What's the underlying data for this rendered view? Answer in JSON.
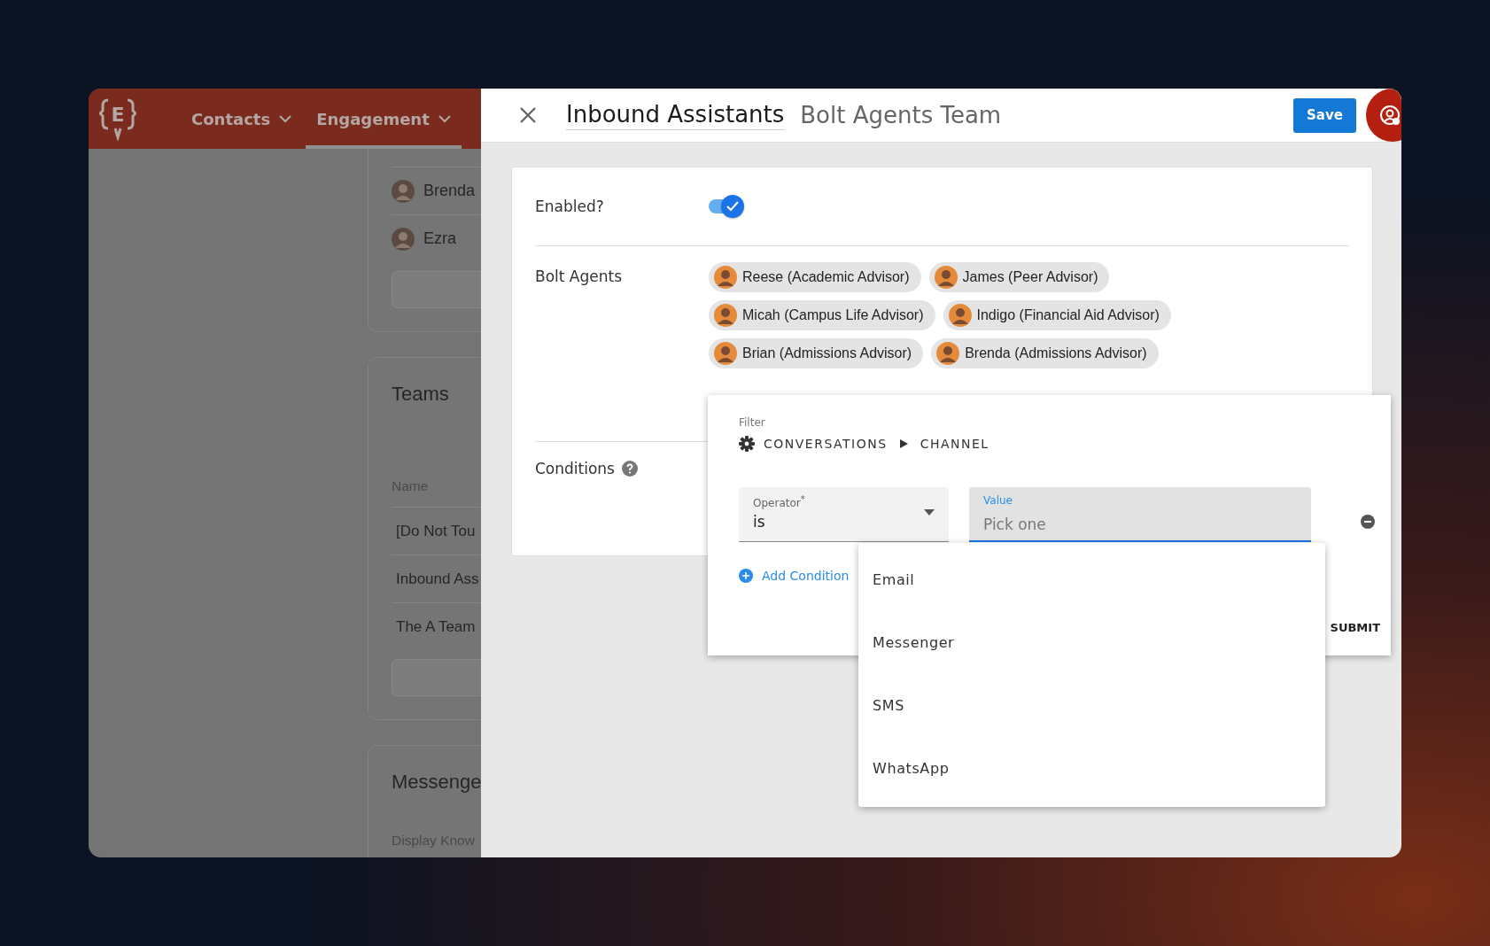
{
  "nav": {
    "logo": "E",
    "items": [
      {
        "label": "Contacts",
        "selected": false
      },
      {
        "label": "Engagement",
        "selected": true
      }
    ]
  },
  "background_page": {
    "people": [
      {
        "name": "Brenda"
      },
      {
        "name": "Ezra"
      }
    ],
    "teams": {
      "title": "Teams",
      "column": "Name",
      "rows": [
        "[Do Not Tou",
        "Inbound Ass",
        "The A Team"
      ]
    },
    "messenger": {
      "title": "Messenge",
      "row": "Display Know"
    }
  },
  "panel": {
    "title": "Inbound Assistants",
    "subtitle": "Bolt Agents Team",
    "save": "Save"
  },
  "form": {
    "enabled": {
      "label": "Enabled?",
      "on": true
    },
    "agents": {
      "label": "Bolt Agents",
      "chips": [
        {
          "label": "Reese (Academic Advisor)"
        },
        {
          "label": "James (Peer Advisor)"
        },
        {
          "label": "Micah (Campus Life Advisor)"
        },
        {
          "label": "Indigo (Financial Aid Advisor)"
        },
        {
          "label": "Brian (Admissions Advisor)"
        },
        {
          "label": "Brenda (Admissions Advisor)"
        }
      ]
    },
    "conditions": {
      "label": "Conditions"
    }
  },
  "filter": {
    "label": "Filter",
    "path": [
      "CONVERSATIONS",
      "CHANNEL"
    ],
    "operator": {
      "label": "Operator$^{*}$",
      "value": "is"
    },
    "value": {
      "label": "Value",
      "placeholder": "Pick one"
    },
    "add": "Add Condition",
    "submit": "SUBMIT"
  },
  "options": [
    {
      "label": "Email"
    },
    {
      "label": "Messenger"
    },
    {
      "label": "SMS"
    },
    {
      "label": "WhatsApp"
    }
  ]
}
